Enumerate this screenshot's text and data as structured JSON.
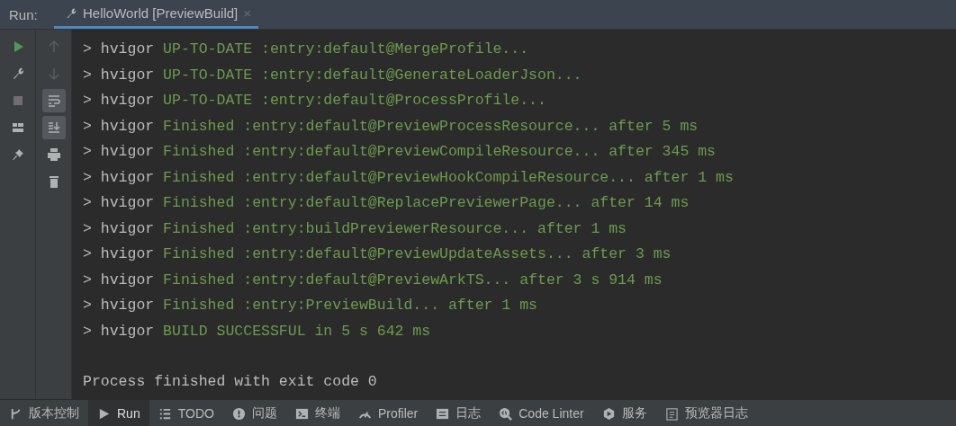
{
  "header": {
    "label": "Run:",
    "tab": {
      "title": "HelloWorld [PreviewBuild]",
      "close": "×",
      "selected": true
    }
  },
  "toolbar_left": [
    {
      "kind": "run",
      "selected": false
    },
    {
      "kind": "wrench",
      "selected": false
    },
    {
      "kind": "stop",
      "selected": false
    },
    {
      "kind": "layout",
      "selected": false
    },
    {
      "kind": "pin",
      "selected": false
    }
  ],
  "toolbar_right": [
    {
      "kind": "up",
      "selected": false
    },
    {
      "kind": "down",
      "selected": false
    },
    {
      "kind": "wrap",
      "selected": true
    },
    {
      "kind": "scroll-end",
      "selected": true
    },
    {
      "kind": "print",
      "selected": false
    },
    {
      "kind": "trash",
      "selected": false
    }
  ],
  "console": [
    {
      "prefix": "> hvigor",
      "text": "UP-TO-DATE :entry:default@MergeProfile..."
    },
    {
      "prefix": "> hvigor",
      "text": "UP-TO-DATE :entry:default@GenerateLoaderJson..."
    },
    {
      "prefix": "> hvigor",
      "text": "UP-TO-DATE :entry:default@ProcessProfile..."
    },
    {
      "prefix": "> hvigor",
      "text": "Finished :entry:default@PreviewProcessResource... after 5 ms"
    },
    {
      "prefix": "> hvigor",
      "text": "Finished :entry:default@PreviewCompileResource... after 345 ms"
    },
    {
      "prefix": "> hvigor",
      "text": "Finished :entry:default@PreviewHookCompileResource... after 1 ms"
    },
    {
      "prefix": "> hvigor",
      "text": "Finished :entry:default@ReplacePreviewerPage... after 14 ms"
    },
    {
      "prefix": "> hvigor",
      "text": "Finished :entry:buildPreviewerResource... after 1 ms"
    },
    {
      "prefix": "> hvigor",
      "text": "Finished :entry:default@PreviewUpdateAssets... after 3 ms"
    },
    {
      "prefix": "> hvigor",
      "text": "Finished :entry:default@PreviewArkTS... after 3 s 914 ms"
    },
    {
      "prefix": "> hvigor",
      "text": "Finished :entry:PreviewBuild... after 1 ms"
    },
    {
      "prefix": "> hvigor",
      "text": "BUILD SUCCESSFUL in 5 s 642 ms"
    }
  ],
  "exit_message": "Process finished with exit code 0",
  "bottom_tabs": [
    {
      "kind": "vcs",
      "label": "版本控制",
      "selected": false
    },
    {
      "kind": "run",
      "label": "Run",
      "selected": true
    },
    {
      "kind": "list",
      "label": "TODO",
      "selected": false
    },
    {
      "kind": "alert",
      "label": "问题",
      "selected": false
    },
    {
      "kind": "terminal",
      "label": "终端",
      "selected": false
    },
    {
      "kind": "gauge",
      "label": "Profiler",
      "selected": false
    },
    {
      "kind": "log",
      "label": "日志",
      "selected": false
    },
    {
      "kind": "lint",
      "label": "Code Linter",
      "selected": false
    },
    {
      "kind": "service",
      "label": "服务",
      "selected": false
    },
    {
      "kind": "doc",
      "label": "预览器日志",
      "selected": false
    }
  ]
}
